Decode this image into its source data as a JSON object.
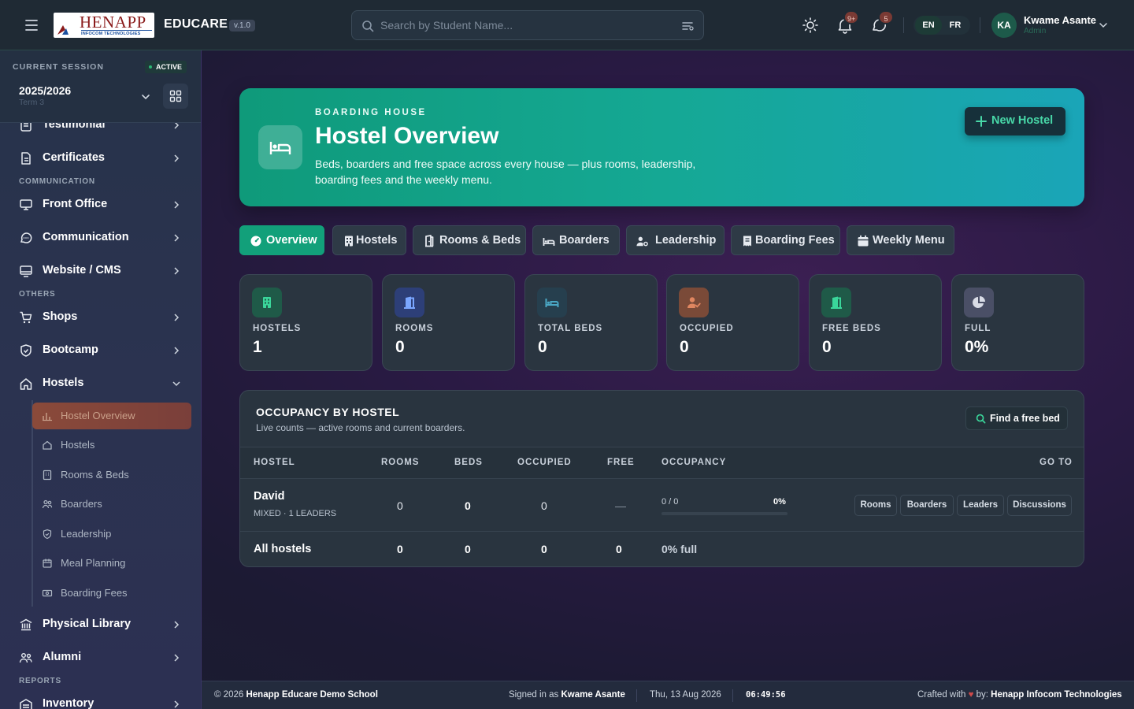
{
  "topbar": {
    "logo_word": "HENAPP",
    "logo_sub": "INFOCOM TECHNOLOGIES",
    "brand": "EDUCARE",
    "version": "v.1.0",
    "search_placeholder": "Search by Student Name...",
    "notifications_badge": "9+",
    "messages_badge": "5",
    "lang_en": "EN",
    "lang_fr": "FR",
    "user_initials": "KA",
    "user_name": "Kwame Asante",
    "user_role": "Admin"
  },
  "sidebar": {
    "session_label": "CURRENT SESSION",
    "session_status": "ACTIVE",
    "session_year": "2025/2026",
    "session_term": "Term 3",
    "items": {
      "testimonial": "Testimonial",
      "certificates": "Certificates",
      "section_communication": "COMMUNICATION",
      "front_office": "Front Office",
      "communication": "Communication",
      "website_cms": "Website / CMS",
      "section_others": "OTHERS",
      "shops": "Shops",
      "bootcamp": "Bootcamp",
      "hostels": "Hostels",
      "physical_library": "Physical Library",
      "alumni": "Alumni",
      "section_reports": "REPORTS",
      "inventory": "Inventory"
    },
    "hostel_sub": {
      "overview": "Hostel Overview",
      "hostels": "Hostels",
      "rooms_beds": "Rooms & Beds",
      "boarders": "Boarders",
      "leadership": "Leadership",
      "meal_planning": "Meal Planning",
      "boarding_fees": "Boarding Fees"
    }
  },
  "hero": {
    "eyebrow": "BOARDING HOUSE",
    "title": "Hostel Overview",
    "description": "Beds, boarders and free space across every house — plus rooms, leadership, boarding fees and the weekly menu.",
    "new_button": "New Hostel"
  },
  "tabs": {
    "overview": "Overview",
    "hostels": "Hostels",
    "rooms_beds": "Rooms & Beds",
    "boarders": "Boarders",
    "leadership": "Leadership",
    "boarding_fees": "Boarding Fees",
    "weekly_menu": "Weekly Menu"
  },
  "stats": {
    "hostels": {
      "label": "HOSTELS",
      "value": "1"
    },
    "rooms": {
      "label": "ROOMS",
      "value": "0"
    },
    "total_beds": {
      "label": "TOTAL BEDS",
      "value": "0"
    },
    "occupied": {
      "label": "OCCUPIED",
      "value": "0"
    },
    "free_beds": {
      "label": "FREE BEDS",
      "value": "0"
    },
    "full": {
      "label": "FULL",
      "value": "0%"
    }
  },
  "occupancy": {
    "title": "OCCUPANCY BY HOSTEL",
    "subtitle": "Live counts — active rooms and current boarders.",
    "find_button": "Find a free bed",
    "columns": {
      "hostel": "HOSTEL",
      "rooms": "ROOMS",
      "beds": "BEDS",
      "occupied": "OCCUPIED",
      "free": "FREE",
      "occupancy": "OCCUPANCY",
      "go_to": "GO TO"
    },
    "row": {
      "name": "David",
      "meta": "MIXED · 1 LEADERS",
      "rooms": "0",
      "beds": "0",
      "occupied": "0",
      "free": "—",
      "ratio": "0 / 0",
      "percent": "0%",
      "percent_value": 0,
      "links": {
        "rooms": "Rooms",
        "boarders": "Boarders",
        "leaders": "Leaders",
        "discussions": "Discussions"
      }
    },
    "total": {
      "name": "All hostels",
      "rooms": "0",
      "beds": "0",
      "occupied": "0",
      "free": "0",
      "full": "0% full"
    }
  },
  "footer": {
    "copyright_prefix": "© 2026",
    "school": "Henapp Educare Demo School",
    "signed_prefix": "Signed in as",
    "signed_user": "Kwame Asante",
    "date": "Thu, 13 Aug 2026",
    "time": "06:49:56",
    "crafted_prefix": "Crafted with",
    "crafted_suffix": "by:",
    "crafted_by": "Henapp Infocom Technologies"
  },
  "colors": {
    "accent": "#12a07a",
    "hero_start": "#0f9a7a",
    "hero_end": "#1aa5b8",
    "active_sub": "#8a4a3a"
  }
}
